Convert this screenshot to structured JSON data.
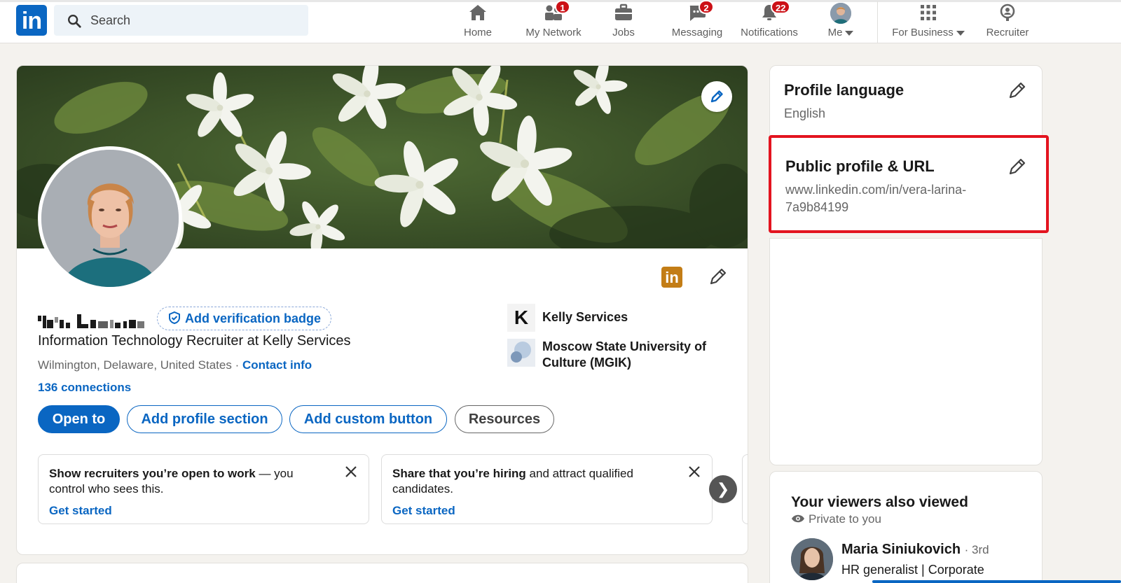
{
  "nav": {
    "search_placeholder": "Search",
    "items": [
      {
        "label": "Home",
        "badge": ""
      },
      {
        "label": "My Network",
        "badge": "1"
      },
      {
        "label": "Jobs",
        "badge": ""
      },
      {
        "label": "Messaging",
        "badge": "2"
      },
      {
        "label": "Notifications",
        "badge": "22"
      },
      {
        "label": "Me",
        "badge": ""
      },
      {
        "label": "For Business",
        "badge": ""
      },
      {
        "label": "Recruiter",
        "badge": ""
      }
    ]
  },
  "profile": {
    "verification_label": "Add verification badge",
    "headline": "Information Technology Recruiter at Kelly Services",
    "location": "Wilmington, Delaware, United States",
    "location_separator": "·",
    "contact_info": "Contact info",
    "connections": "136 connections",
    "organizations": [
      {
        "name": "Kelly Services",
        "logo_letter": "K"
      },
      {
        "name": "Moscow State University of Culture (MGIK)",
        "logo_letter": ""
      }
    ],
    "buttons": {
      "open_to": "Open to",
      "add_section": "Add profile section",
      "add_custom": "Add custom button",
      "resources": "Resources"
    },
    "promos": [
      {
        "bold": "Show recruiters you’re open to work",
        "rest": " — you control who sees this.",
        "link": "Get started"
      },
      {
        "bold": "Share that you’re hiring",
        "rest": " and attract qualified candidates.",
        "link": "Get started"
      }
    ]
  },
  "sidebar": {
    "language": {
      "title": "Profile language",
      "value": "English"
    },
    "public_url": {
      "title": "Public profile & URL",
      "url_line1": "www.linkedin.com/in/vera-larina-",
      "url_line2": "7a9b84199"
    },
    "viewers": {
      "title": "Your viewers also viewed",
      "private": "Private to you",
      "person": {
        "name": "Maria Siniukovich",
        "degree": "· 3rd",
        "title": "HR generalist | Corporate"
      }
    }
  },
  "colors": {
    "brand": "#0a66c2",
    "highlight": "#e3141f",
    "badge": "#cc1016"
  }
}
